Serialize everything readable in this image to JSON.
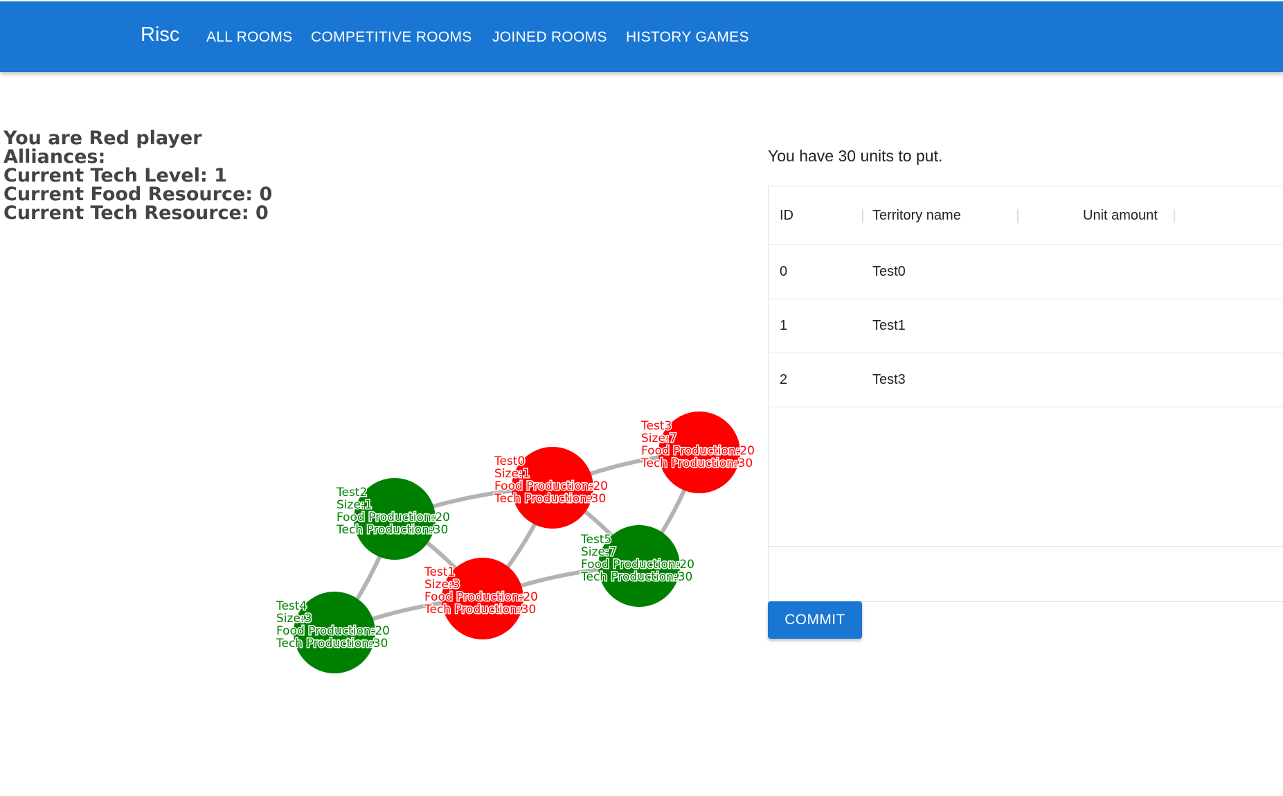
{
  "header": {
    "brand": "Risc",
    "nav": [
      "ALL ROOMS",
      "COMPETITIVE ROOMS",
      "JOINED ROOMS",
      "HISTORY GAMES"
    ],
    "color": "#1976d2"
  },
  "player_info": {
    "line1": "You are Red player",
    "line2": "Alliances:",
    "line3": "Current Tech Level: 1",
    "line4": "Current Food Resource: 0",
    "line5": "Current Tech Resource: 0"
  },
  "map": {
    "colors": {
      "red": "#ff0000",
      "green": "#008000",
      "edge": "#b3b3b3"
    },
    "territories": [
      {
        "name": "Test0",
        "owner": "red",
        "size": "Size:1",
        "food": "Food Production:20",
        "tech": "Tech Production:30"
      },
      {
        "name": "Test1",
        "owner": "red",
        "size": "Size:3",
        "food": "Food Production:20",
        "tech": "Tech Production:30"
      },
      {
        "name": "Test2",
        "owner": "green",
        "size": "Size:1",
        "food": "Food Production:20",
        "tech": "Tech Production:30"
      },
      {
        "name": "Test3",
        "owner": "red",
        "size": "Size:7",
        "food": "Food Production:20",
        "tech": "Tech Production:30"
      },
      {
        "name": "Test4",
        "owner": "green",
        "size": "Size:3",
        "food": "Food Production:20",
        "tech": "Tech Production:30"
      },
      {
        "name": "Test5",
        "owner": "green",
        "size": "Size:7",
        "food": "Food Production:20",
        "tech": "Tech Production:30"
      }
    ],
    "edges": [
      [
        "Test2",
        "Test0"
      ],
      [
        "Test0",
        "Test3"
      ],
      [
        "Test0",
        "Test1"
      ],
      [
        "Test0",
        "Test5"
      ],
      [
        "Test3",
        "Test5"
      ],
      [
        "Test2",
        "Test4"
      ],
      [
        "Test2",
        "Test1"
      ],
      [
        "Test4",
        "Test1"
      ],
      [
        "Test1",
        "Test5"
      ]
    ]
  },
  "placement": {
    "message": "You have 30 units to put.",
    "columns": [
      "ID",
      "Territory name",
      "Unit amount"
    ],
    "rows": [
      {
        "id": "0",
        "name": "Test0",
        "amount": ""
      },
      {
        "id": "1",
        "name": "Test1",
        "amount": ""
      },
      {
        "id": "2",
        "name": "Test3",
        "amount": ""
      }
    ],
    "commit_label": "COMMIT"
  }
}
